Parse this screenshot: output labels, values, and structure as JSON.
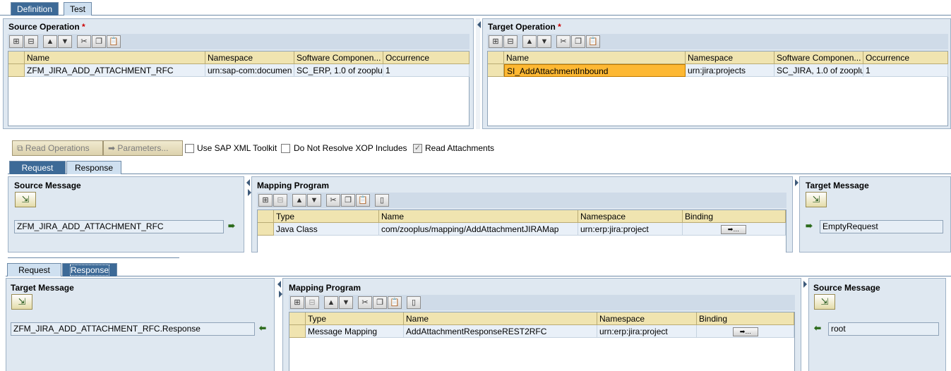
{
  "top_tabs": [
    "Definition",
    "Test"
  ],
  "source_operation": {
    "title": "Source Operation",
    "required": "*",
    "columns": [
      "Name",
      "Namespace",
      "Software Componen...",
      "Occurrence"
    ],
    "row": [
      "ZFM_JIRA_ADD_ATTACHMENT_RFC",
      "urn:sap-com:documen",
      "SC_ERP, 1.0 of zooplu",
      "1"
    ]
  },
  "target_operation": {
    "title": "Target Operation",
    "required": "*",
    "columns": [
      "Name",
      "Namespace",
      "Software Componen...",
      "Occurrence"
    ],
    "row": [
      "SI_AddAttachmentInbound",
      "urn:jira:projects",
      "SC_JIRA, 1.0 of zooplu",
      "1"
    ]
  },
  "toolbar_icons": [
    "insert-row-icon",
    "delete-row-icon",
    "move-up-icon",
    "move-down-icon",
    "cut-icon",
    "copy-icon",
    "paste-icon"
  ],
  "actions": {
    "read_operations": "Read Operations",
    "parameters": "Parameters...",
    "use_sap_xml_toolkit": "Use SAP XML Toolkit",
    "do_not_resolve_xop": "Do Not Resolve XOP Includes",
    "read_attachments": "Read Attachments"
  },
  "request_section": {
    "tabs": [
      "Request",
      "Response"
    ],
    "source_title": "Source Message",
    "source_value": "ZFM_JIRA_ADD_ATTACHMENT_RFC",
    "mapping_title": "Mapping Program",
    "columns": [
      "Type",
      "Name",
      "Namespace",
      "Binding"
    ],
    "row": [
      "Java Class",
      "com/zooplus/mapping/AddAttachmentJIRAMap",
      "urn:erp:jira:project",
      ""
    ],
    "target_title": "Target Message",
    "target_value": "EmptyRequest"
  },
  "response_section": {
    "tabs": [
      "Request",
      "Response"
    ],
    "target_title": "Target Message",
    "target_value": "ZFM_JIRA_ADD_ATTACHMENT_RFC.Response",
    "mapping_title": "Mapping Program",
    "columns": [
      "Type",
      "Name",
      "Namespace",
      "Binding"
    ],
    "row": [
      "Message Mapping",
      "AddAttachmentResponseREST2RFC",
      "urn:erp:jira:project",
      ""
    ],
    "source_title": "Source Message",
    "source_value": "root"
  },
  "colors": {
    "tab_active": "#3d6a97",
    "panel_bg": "#dfe8f1",
    "header_bg": "#f0e4b0",
    "highlight": "#fdb833"
  }
}
